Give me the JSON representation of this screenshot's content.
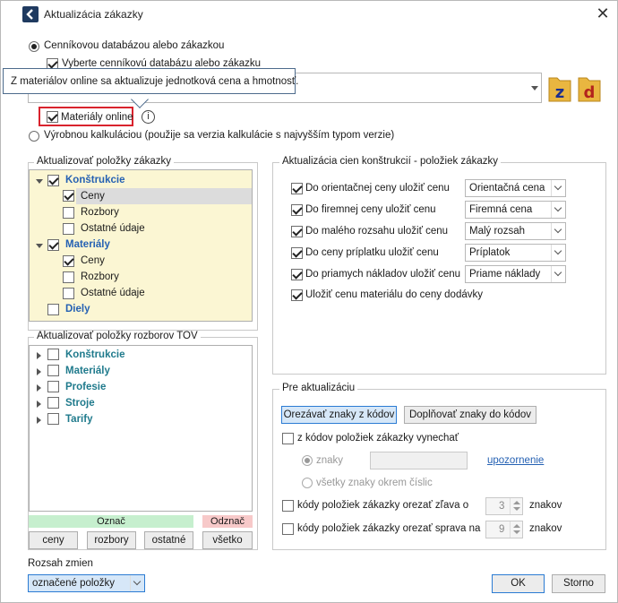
{
  "window": {
    "title": "Aktualizácia zákazky",
    "close_label": "✕"
  },
  "source": {
    "option_price_db": "Cenníkovou databázou alebo zákazkou",
    "select_db_checkbox": "Vyberte cenníkovú databázu alebo zákazku",
    "materials_online": "Materiály online",
    "option_production": "Výrobnou kalkuláciou (použije sa verzia kalkulácie s najvyšším typom verzie)",
    "tooltip": "Z materiálov online sa aktualizuje jednotková cena a hmotnosť.",
    "folder_icons": [
      "z",
      "d"
    ]
  },
  "items_group": {
    "title": "Aktualizovať položky zákazky",
    "tree": [
      {
        "label": "Konštrukcie",
        "checked": true,
        "children": [
          {
            "label": "Ceny",
            "checked": true
          },
          {
            "label": "Rozbory",
            "checked": false
          },
          {
            "label": "Ostatné údaje",
            "checked": false
          }
        ]
      },
      {
        "label": "Materiály",
        "checked": true,
        "children": [
          {
            "label": "Ceny",
            "checked": true
          },
          {
            "label": "Rozbory",
            "checked": false
          },
          {
            "label": "Ostatné údaje",
            "checked": false
          }
        ]
      },
      {
        "label": "Diely",
        "checked": false
      }
    ]
  },
  "tov_group": {
    "title": "Aktualizovať položky rozborov TOV",
    "items": [
      "Konštrukcie",
      "Materiály",
      "Profesie",
      "Stroje",
      "Tarify"
    ]
  },
  "mark_bar": {
    "mark": "Označ",
    "unmark": "Odznač",
    "buttons": [
      "ceny",
      "rozbory",
      "ostatné",
      "všetko"
    ]
  },
  "range": {
    "label": "Rozsah zmien",
    "value": "označené položky"
  },
  "prices_group": {
    "title": "Aktualizácia cien konštrukcií - položiek zákazky",
    "rows": [
      {
        "label": "Do orientačnej ceny uložiť cenu",
        "value": "Orientačná cena"
      },
      {
        "label": "Do firemnej ceny uložiť cenu",
        "value": "Firemná cena"
      },
      {
        "label": "Do malého rozsahu uložiť cenu",
        "value": "Malý rozsah"
      },
      {
        "label": "Do ceny príplatku uložiť cenu",
        "value": "Príplatok"
      },
      {
        "label": "Do priamych nákladov uložiť cenu",
        "value": "Priame náklady"
      }
    ],
    "material_price": "Uložiť cenu materiálu do ceny dodávky"
  },
  "pre_group": {
    "title": "Pre aktualizáciu",
    "btn_trim": "Orezávať znaky z kódov",
    "btn_fill": "Doplňovať znaky do kódov",
    "omit_codes": "z kódov položiek zákazky vynechať",
    "chars_label": "znaky",
    "warning_link": "upozornenie",
    "all_except_digits": "všetky znaky okrem číslic",
    "trim_left": "kódy položiek zákazky orezať zľava o",
    "trim_left_value": "3",
    "trim_right": "kódy položiek zákazky orezať sprava na",
    "trim_right_value": "9",
    "unit": "znakov"
  },
  "footer": {
    "ok": "OK",
    "cancel": "Storno"
  },
  "colors": {
    "accent": "#2b7bd3",
    "tree_bg": "#fbf6d3",
    "mark_green": "#c6efce",
    "unmark_red": "#f7c9c9",
    "highlight_red": "#d9232d"
  }
}
